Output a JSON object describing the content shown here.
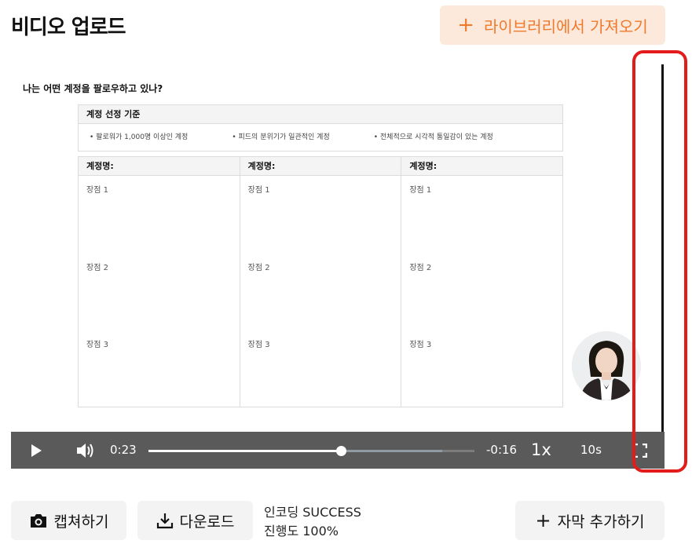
{
  "header": {
    "title": "비디오 업로드",
    "import_label": "라이브러리에서 가져오기"
  },
  "slide": {
    "question": "나는 어떤 계정을 팔로우하고 있나?",
    "criteria_title": "계정 선정 기준",
    "criteria": [
      "팔로워가 1,000명 이상인 계정",
      "피드의 분위기가 일관적인 계정",
      "전체적으로 시각적 통일감이 있는 계정"
    ],
    "columns": [
      {
        "header": "계정명:",
        "items": [
          "장점 1",
          "장점 2",
          "장점 3"
        ]
      },
      {
        "header": "계정명:",
        "items": [
          "장점 1",
          "장점 2",
          "장점 3"
        ]
      },
      {
        "header": "계정명:",
        "items": [
          "장점 1",
          "장점 2",
          "장점 3"
        ]
      }
    ]
  },
  "player": {
    "current_time": "0:23",
    "remaining_time": "-0:16",
    "speed": "1x",
    "skip": "10s",
    "progress": 0.59,
    "buffered": 0.9
  },
  "actions": {
    "capture_label": "캡쳐하기",
    "download_label": "다운로드",
    "encoding_status": "인코딩 SUCCESS",
    "progress_status": "진행도 100%",
    "add_subtitle_label": "자막 추가하기"
  },
  "colors": {
    "accent": "#f07a2c",
    "accent_bg": "#fde9dc",
    "highlight": "#e31b1b",
    "controls_bg": "#5a5a5a"
  },
  "icons": [
    "plus-icon",
    "play-icon",
    "volume-icon",
    "fullscreen-icon",
    "camera-icon",
    "download-icon"
  ]
}
